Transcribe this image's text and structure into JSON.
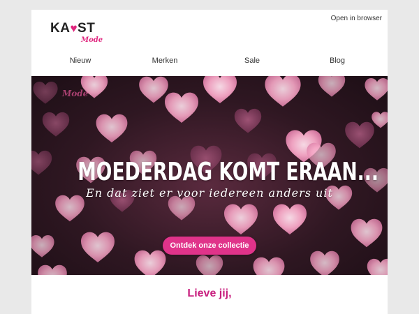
{
  "header": {
    "open_in_browser": "Open in browser",
    "logo_text_start": "KA",
    "logo_heart_glyph": "♥",
    "logo_text_end": "ST",
    "logo_sub": "Mode"
  },
  "nav": {
    "items": [
      "Nieuw",
      "Merken",
      "Sale",
      "Blog"
    ]
  },
  "hero": {
    "logo_text": "Mode",
    "title": "MOEDERDAG KOMT ERAAN...",
    "subtitle": "En dat ziet er voor iedereen anders uit",
    "cta_label": "Ontdek onze collectie"
  },
  "body": {
    "greeting": "Lieve jij,"
  },
  "colors": {
    "accent": "#e0338a",
    "greeting": "#c81f7e",
    "hero_bg": "#2f1722"
  }
}
